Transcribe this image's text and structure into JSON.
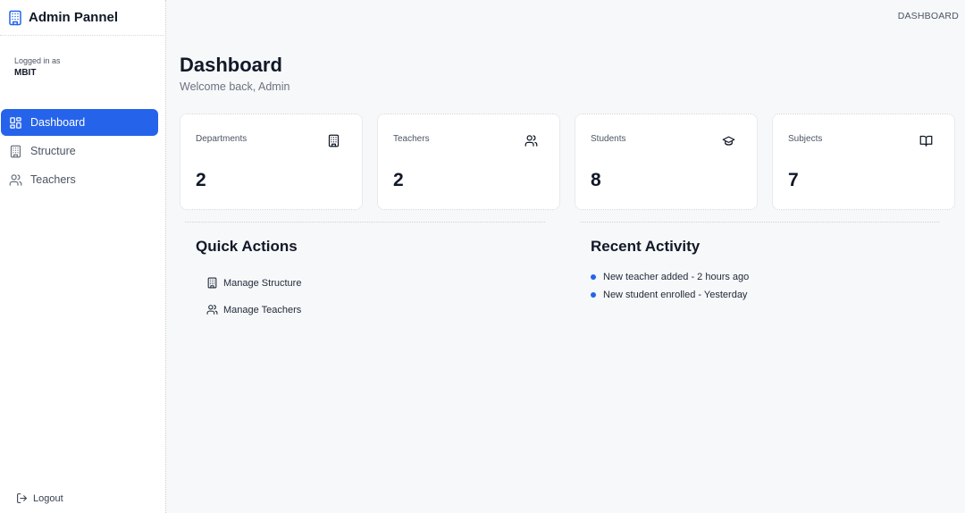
{
  "app": {
    "title": "Admin Pannel",
    "breadcrumb": "DASHBOARD"
  },
  "sidebar": {
    "logged_label": "Logged in as",
    "logged_user": "MBIT",
    "items": [
      {
        "label": "Dashboard",
        "icon": "dashboard-icon",
        "active": true
      },
      {
        "label": "Structure",
        "icon": "building-icon",
        "active": false
      },
      {
        "label": "Teachers",
        "icon": "users-icon",
        "active": false
      }
    ],
    "logout_label": "Logout"
  },
  "header": {
    "title": "Dashboard",
    "subtitle": "Welcome back, Admin"
  },
  "stats": [
    {
      "label": "Departments",
      "value": "2",
      "icon": "building-icon"
    },
    {
      "label": "Teachers",
      "value": "2",
      "icon": "users-icon"
    },
    {
      "label": "Students",
      "value": "8",
      "icon": "graduation-cap-icon"
    },
    {
      "label": "Subjects",
      "value": "7",
      "icon": "book-icon"
    }
  ],
  "quick_actions": {
    "title": "Quick Actions",
    "items": [
      {
        "label": "Manage Structure",
        "icon": "building-icon"
      },
      {
        "label": "Manage Teachers",
        "icon": "users-icon"
      }
    ]
  },
  "recent_activity": {
    "title": "Recent Activity",
    "items": [
      {
        "text": "New teacher added - 2 hours ago"
      },
      {
        "text": "New student enrolled - Yesterday"
      }
    ]
  },
  "colors": {
    "accent": "#2563eb",
    "background": "#f7f8fa",
    "text": "#111827"
  }
}
